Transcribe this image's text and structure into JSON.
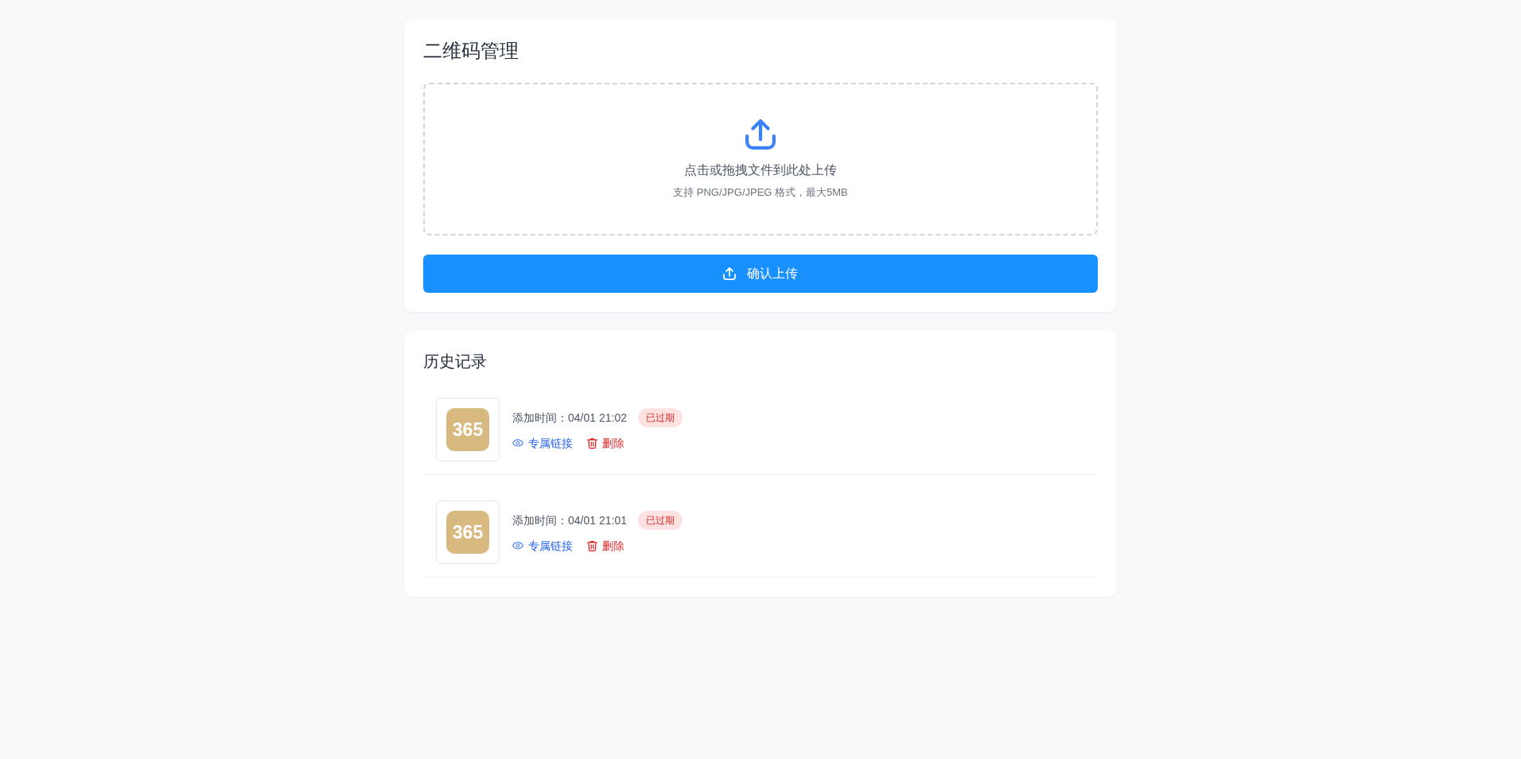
{
  "upload_card": {
    "title": "二维码管理",
    "dropzone": {
      "prompt": "点击或拖拽文件到此处上传",
      "hint": "支持 PNG/JPG/JPEG 格式，最大5MB"
    },
    "button": "确认上传"
  },
  "history": {
    "title": "历史记录",
    "records": [
      {
        "logo_text": "365",
        "added_time": "添加时间：04/01 21:02",
        "status": "已过期",
        "expired": true,
        "link": "专属链接",
        "delete": "删除"
      },
      {
        "logo_text": "365",
        "added_time": "添加时间：04/01 21:01",
        "status": "已过期",
        "expired": true,
        "link": "专属链接",
        "delete": "删除"
      }
    ]
  }
}
